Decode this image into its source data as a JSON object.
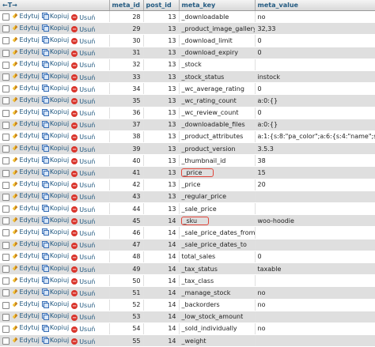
{
  "header": {
    "arrows": "←T→",
    "columns": [
      "meta_id",
      "post_id",
      "meta_key",
      "meta_value"
    ]
  },
  "actions": {
    "edit": "Edytuj",
    "copy": "Kopiuj",
    "delete": "Usuń"
  },
  "rows": [
    {
      "meta_id": "28",
      "post_id": "13",
      "meta_key": "_downloadable",
      "meta_value": "no"
    },
    {
      "meta_id": "29",
      "post_id": "13",
      "meta_key": "_product_image_gallery",
      "meta_value": "32,33"
    },
    {
      "meta_id": "30",
      "post_id": "13",
      "meta_key": "_download_limit",
      "meta_value": "0"
    },
    {
      "meta_id": "31",
      "post_id": "13",
      "meta_key": "_download_expiry",
      "meta_value": "0"
    },
    {
      "meta_id": "32",
      "post_id": "13",
      "meta_key": "_stock",
      "meta_value": ""
    },
    {
      "meta_id": "33",
      "post_id": "13",
      "meta_key": "_stock_status",
      "meta_value": "instock"
    },
    {
      "meta_id": "34",
      "post_id": "13",
      "meta_key": "_wc_average_rating",
      "meta_value": "0"
    },
    {
      "meta_id": "35",
      "post_id": "13",
      "meta_key": "_wc_rating_count",
      "meta_value": "a:0:{}"
    },
    {
      "meta_id": "36",
      "post_id": "13",
      "meta_key": "_wc_review_count",
      "meta_value": "0"
    },
    {
      "meta_id": "37",
      "post_id": "13",
      "meta_key": "_downloadable_files",
      "meta_value": "a:0:{}"
    },
    {
      "meta_id": "38",
      "post_id": "13",
      "meta_key": "_product_attributes",
      "meta_value": "a:1:{s:8:\"pa_color\";a:6:{s:4:\"name\";s:8:\"pa_color\"..."
    },
    {
      "meta_id": "39",
      "post_id": "13",
      "meta_key": "_product_version",
      "meta_value": "3.5.3"
    },
    {
      "meta_id": "40",
      "post_id": "13",
      "meta_key": "_thumbnail_id",
      "meta_value": "38"
    },
    {
      "meta_id": "41",
      "post_id": "13",
      "meta_key": "_price",
      "meta_value": "15",
      "highlight": true
    },
    {
      "meta_id": "42",
      "post_id": "13",
      "meta_key": "_price",
      "meta_value": "20"
    },
    {
      "meta_id": "43",
      "post_id": "13",
      "meta_key": "_regular_price",
      "meta_value": ""
    },
    {
      "meta_id": "44",
      "post_id": "13",
      "meta_key": "_sale_price",
      "meta_value": ""
    },
    {
      "meta_id": "45",
      "post_id": "14",
      "meta_key": "_sku",
      "meta_value": "woo-hoodie",
      "highlight": true
    },
    {
      "meta_id": "46",
      "post_id": "14",
      "meta_key": "_sale_price_dates_from",
      "meta_value": ""
    },
    {
      "meta_id": "47",
      "post_id": "14",
      "meta_key": "_sale_price_dates_to",
      "meta_value": ""
    },
    {
      "meta_id": "48",
      "post_id": "14",
      "meta_key": "total_sales",
      "meta_value": "0"
    },
    {
      "meta_id": "49",
      "post_id": "14",
      "meta_key": "_tax_status",
      "meta_value": "taxable"
    },
    {
      "meta_id": "50",
      "post_id": "14",
      "meta_key": "_tax_class",
      "meta_value": ""
    },
    {
      "meta_id": "51",
      "post_id": "14",
      "meta_key": "_manage_stock",
      "meta_value": "no"
    },
    {
      "meta_id": "52",
      "post_id": "14",
      "meta_key": "_backorders",
      "meta_value": "no"
    },
    {
      "meta_id": "53",
      "post_id": "14",
      "meta_key": "_low_stock_amount",
      "meta_value": ""
    },
    {
      "meta_id": "54",
      "post_id": "14",
      "meta_key": "_sold_individually",
      "meta_value": "no"
    },
    {
      "meta_id": "55",
      "post_id": "14",
      "meta_key": "_weight",
      "meta_value": ""
    }
  ],
  "colors": {
    "highlight": "#e0453a",
    "link": "#235a81",
    "stripe": "#dfdfdf"
  }
}
